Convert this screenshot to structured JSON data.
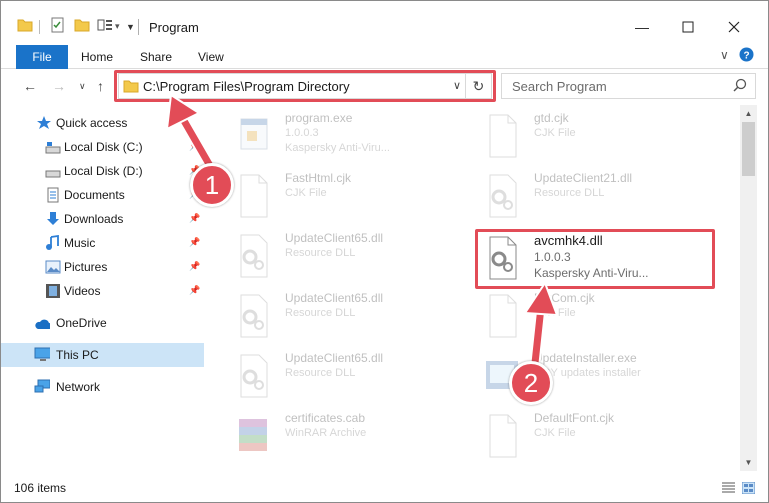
{
  "window": {
    "title": "Program"
  },
  "ribbon": {
    "tabs": [
      "File",
      "Home",
      "Share",
      "View"
    ]
  },
  "address": {
    "path": "C:\\Program Files\\Program Directory"
  },
  "search": {
    "placeholder": "Search Program"
  },
  "sidebar": {
    "items": [
      {
        "label": "Quick access"
      },
      {
        "label": "Local Disk (C:)"
      },
      {
        "label": "Local Disk (D:)"
      },
      {
        "label": "Documents"
      },
      {
        "label": "Downloads"
      },
      {
        "label": "Music"
      },
      {
        "label": "Pictures"
      },
      {
        "label": "Videos"
      },
      {
        "label": "OneDrive"
      },
      {
        "label": "This PC"
      },
      {
        "label": "Network"
      }
    ]
  },
  "files": [
    {
      "name": "program.exe",
      "line1": "1.0.0.3",
      "line2": "Kaspersky Anti-Viru...",
      "icon": "exe-icon"
    },
    {
      "name": "gtd.cjk",
      "line1": "CJK File",
      "line2": "",
      "icon": "blank-file-icon"
    },
    {
      "name": "FastHtml.cjk",
      "line1": "CJK File",
      "line2": "",
      "icon": "blank-file-icon"
    },
    {
      "name": "UpdateClient21.dll",
      "line1": "Resource DLL",
      "line2": "",
      "icon": "dll-icon"
    },
    {
      "name": "UpdateClient65.dll",
      "line1": "Resource DLL",
      "line2": "",
      "icon": "dll-icon"
    },
    {
      "name": "avcmhk4.dll",
      "line1": "1.0.0.3",
      "line2": "Kaspersky Anti-Viru...",
      "icon": "dll-icon"
    },
    {
      "name": "UpdateClient65.dll",
      "line1": "Resource DLL",
      "line2": "",
      "icon": "dll-icon"
    },
    {
      "name": "ExtCom.cjk",
      "line1": "CJK File",
      "line2": "",
      "icon": "blank-file-icon"
    },
    {
      "name": "UpdateClient65.dll",
      "line1": "Resource DLL",
      "line2": "",
      "icon": "dll-icon"
    },
    {
      "name": "UpdateInstaller.exe",
      "line1": "...BY updates installer",
      "line2": "",
      "icon": "installer-icon"
    },
    {
      "name": "certificates.cab",
      "line1": "WinRAR Archive",
      "line2": "",
      "icon": "archive-icon"
    },
    {
      "name": "DefaultFont.cjk",
      "line1": "CJK File",
      "line2": "",
      "icon": "blank-file-icon"
    }
  ],
  "status": {
    "count": "106 items"
  },
  "annotations": {
    "badge1": "1",
    "badge2": "2"
  },
  "colors": {
    "accent": "#1a73c9",
    "highlight": "#e24c57",
    "selected": "#cce4f7"
  }
}
